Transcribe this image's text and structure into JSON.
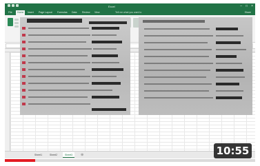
{
  "video": {
    "duration": "10:55",
    "progress_fraction": 0.12,
    "progress_color": "#e31b23"
  },
  "app": {
    "title": "Excel",
    "accent": "#217346"
  },
  "ribbon": {
    "tabs": [
      "File",
      "Home",
      "Insert",
      "Page Layout",
      "Formulas",
      "Data",
      "Review",
      "View"
    ],
    "active_tab": "Home",
    "tell_me": "Tell me what you want to do",
    "share": "Share"
  },
  "formula_bar": {
    "fx": "fx"
  },
  "sheet": {
    "tabs": [
      "Sheet1",
      "Sheet2",
      "Sheet3"
    ],
    "active_tab": "Sheet3"
  }
}
